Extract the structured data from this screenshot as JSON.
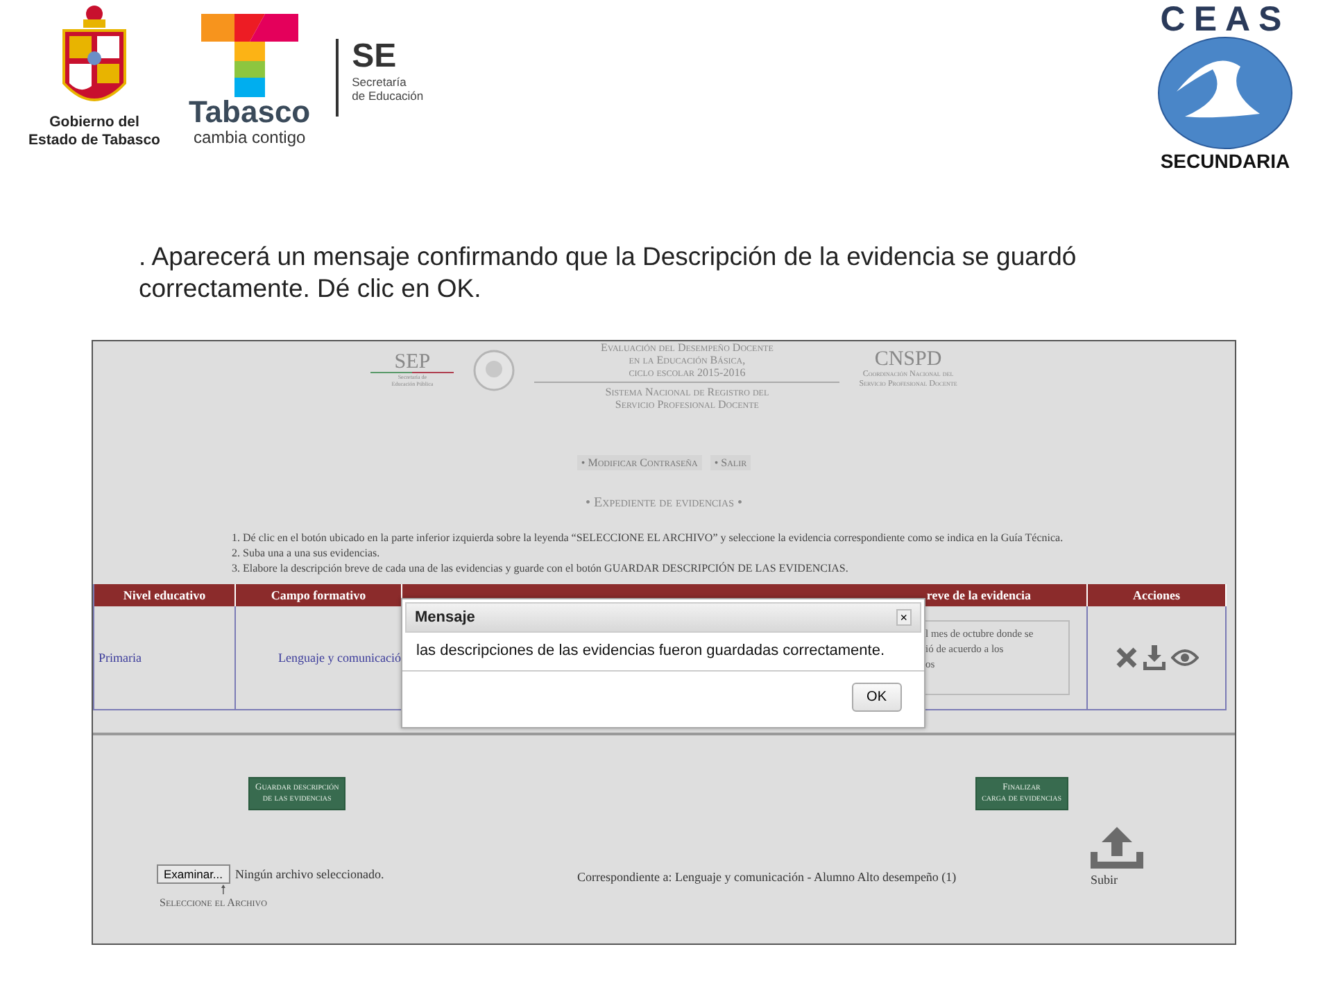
{
  "logos": {
    "state": [
      "Gobierno del",
      "Estado de Tabasco"
    ],
    "tabasco": {
      "name": "Tabasco",
      "slogan": "cambia contigo"
    },
    "se": {
      "abbr": "SE",
      "name": [
        "Secretaría",
        "de Educación"
      ]
    },
    "ceas": {
      "name": "CEAS",
      "level": "SECUNDARIA"
    }
  },
  "instruction": ". Aparecerá un mensaje confirmando que la Descripción de la evidencia se guardó correctamente. Dé clic en OK.",
  "screenshot": {
    "header": {
      "sep": "SEP",
      "sep_sub": [
        "Secretaría de",
        "Educación Pública"
      ],
      "title": [
        "Evaluación del Desempeño Docente",
        "en la Educación Básica,",
        "ciclo escolar 2015-2016"
      ],
      "subtitle": [
        "Sistema Nacional de Registro del",
        "Servicio Profesional Docente"
      ],
      "cnspd": "CNSPD",
      "cnspd_sub": [
        "Coordinación Nacional del",
        "Servicio Profesional Docente"
      ]
    },
    "menu": [
      "• Modificar Contraseña",
      "• Salir"
    ],
    "section_title": "• Expediente de evidencias •",
    "steps": [
      "1. Dé clic en el botón ubicado en la parte inferior izquierda sobre la leyenda “SELECCIONE EL ARCHIVO” y seleccione la evidencia correspondiente como se indica en la Guía Técnica.",
      "2. Suba una a una sus evidencias.",
      "3. Elabore la descripción breve de cada una de las evidencias y guarde con el botón GUARDAR DESCRIPCIÓN DE LAS EVIDENCIAS."
    ],
    "table": {
      "columns": [
        "Nivel educativo",
        "Campo formativo",
        "reve de la evidencia",
        "Acciones"
      ],
      "rows": [
        {
          "level": "Primaria",
          "field": "Lenguaje y comunicació",
          "description": [
            "l mes de octubre donde se",
            "ió de acuerdo a los",
            "os"
          ]
        }
      ]
    },
    "dialog": {
      "title": "Mensaje",
      "close": "×",
      "message": "las descripciones de las evidencias fueron guardadas correctamente.",
      "button": "OK"
    },
    "buttons": [
      [
        "Guardar descripción",
        "de las evidencias"
      ],
      [
        "Finalizar",
        "carga de evidencias"
      ]
    ],
    "file": {
      "button": "Examinar...",
      "status": "Ningún archivo seleccionado.",
      "hint": "Seleccione el Archivo",
      "arrow": "🠕"
    },
    "correspondence": "Correspondiente a: Lenguaje y comunicación - Alumno Alto desempeño (1)",
    "upload": "Subir"
  }
}
